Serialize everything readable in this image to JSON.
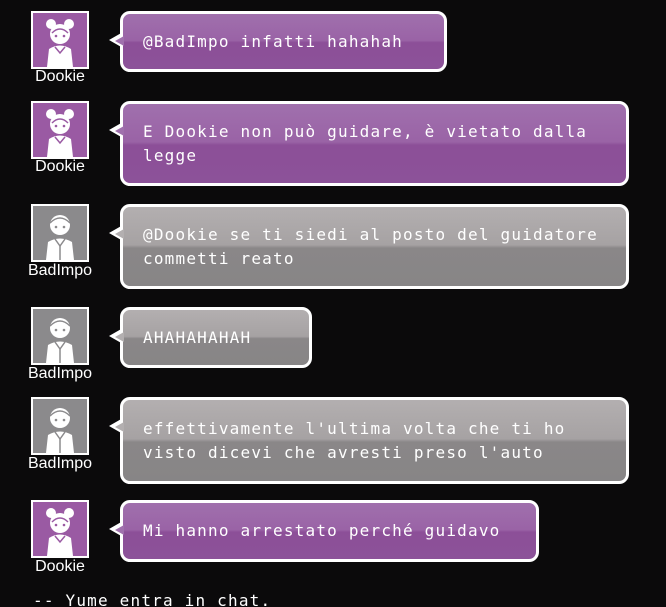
{
  "messages": [
    {
      "user": "Dookie",
      "text": "@BadImpo infatti hahahah",
      "theme": "purple"
    },
    {
      "user": "Dookie",
      "text": "E Dookie non può guidare, è vietato dalla legge",
      "theme": "purple"
    },
    {
      "user": "BadImpo",
      "text": "@Dookie se ti siedi al posto del guidatore commetti reato",
      "theme": "gray"
    },
    {
      "user": "BadImpo",
      "text": "AHAHAHAHAH",
      "theme": "gray"
    },
    {
      "user": "BadImpo",
      "text": "effettivamente l'ultima volta che ti ho visto dicevi che avresti preso l'auto",
      "theme": "gray"
    },
    {
      "user": "Dookie",
      "text": "Mi hanno arrestato perché guidavo",
      "theme": "purple"
    }
  ],
  "system_message": "-- Yume entra in chat.",
  "colors": {
    "background": "#0b0a0b",
    "purple_bubble": "#9a63a6",
    "gray_bubble": "#9a9697",
    "border": "#ffffff"
  },
  "icons": {
    "dookie_avatar": "girl-avatar-icon",
    "badimpo_avatar": "boy-avatar-icon"
  }
}
